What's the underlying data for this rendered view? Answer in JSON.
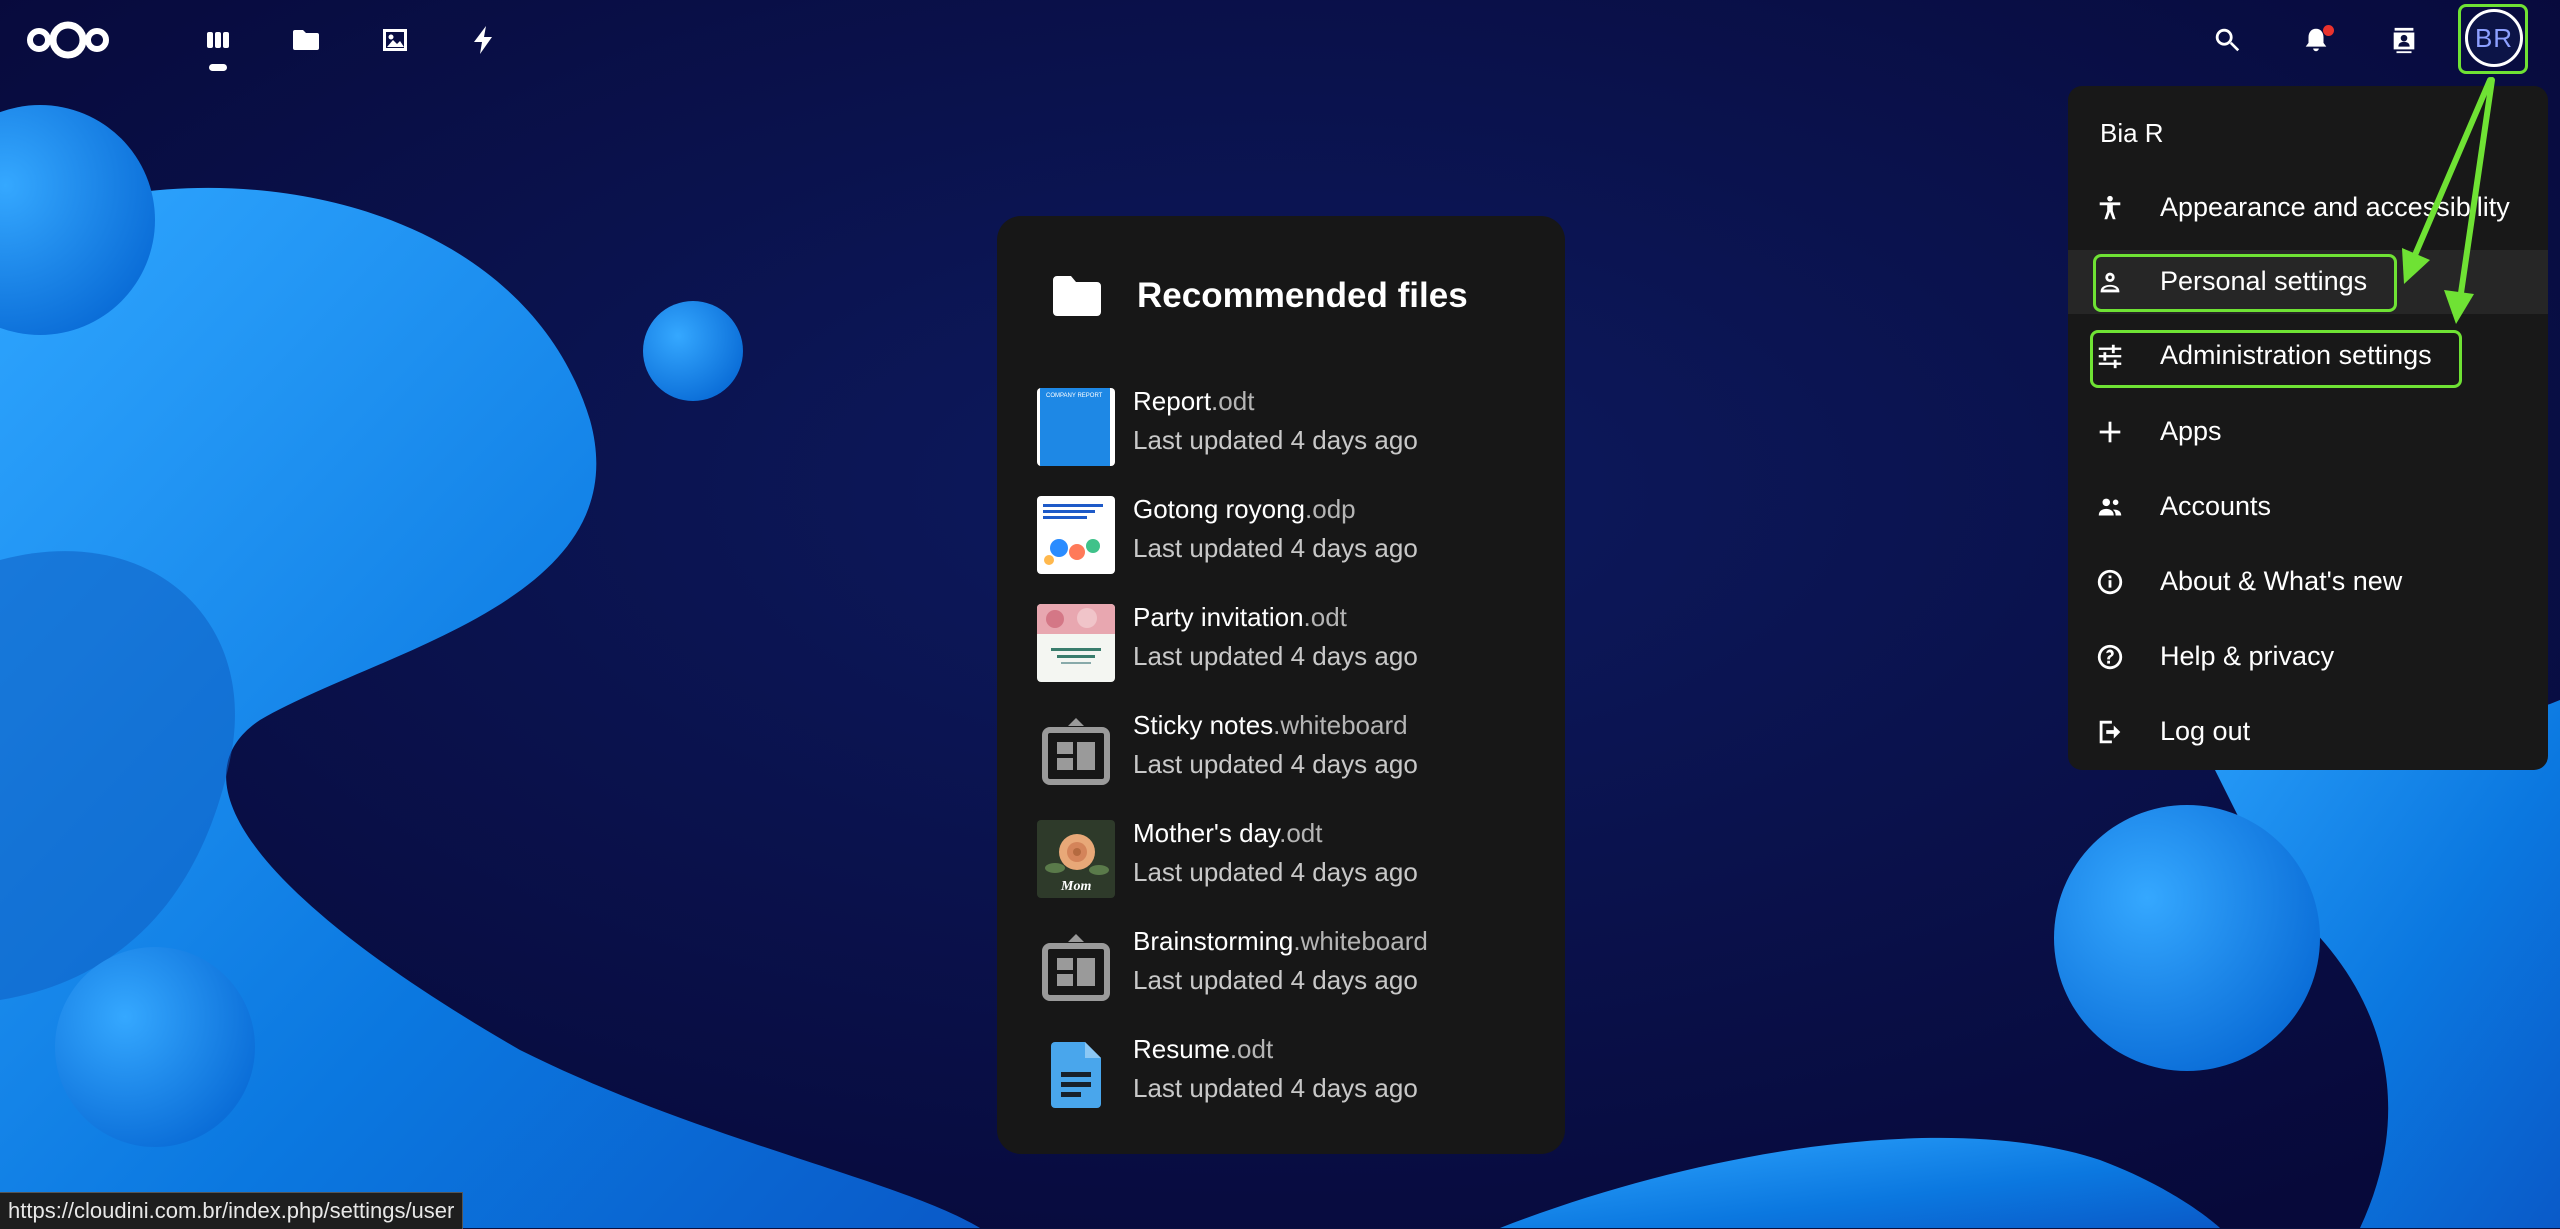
{
  "topbar": {
    "apps": [
      {
        "name": "dashboard",
        "icon": "dashboard-icon",
        "active": true
      },
      {
        "name": "files",
        "icon": "folder-icon"
      },
      {
        "name": "photos",
        "icon": "image-icon"
      },
      {
        "name": "activity",
        "icon": "lightning-icon"
      }
    ],
    "right_icons": [
      "search-icon",
      "bell-icon",
      "contacts-icon"
    ],
    "avatar_initials": "BR"
  },
  "recommended": {
    "title": "Recommended files",
    "files": [
      {
        "name": "Report",
        "ext": ".odt",
        "updated": "Last updated 4 days ago",
        "thumb": "report-thumbnail"
      },
      {
        "name": "Gotong royong",
        "ext": ".odp",
        "updated": "Last updated 4 days ago",
        "thumb": "presentation-thumbnail"
      },
      {
        "name": "Party invitation",
        "ext": ".odt",
        "updated": "Last updated 4 days ago",
        "thumb": "invitation-thumbnail"
      },
      {
        "name": "Sticky notes",
        "ext": ".whiteboard",
        "updated": "Last updated 4 days ago",
        "thumb": "whiteboard-icon"
      },
      {
        "name": "Mother's day",
        "ext": ".odt",
        "updated": "Last updated 4 days ago",
        "thumb": "flower-thumbnail"
      },
      {
        "name": "Brainstorming",
        "ext": ".whiteboard",
        "updated": "Last updated 4 days ago",
        "thumb": "whiteboard-icon"
      },
      {
        "name": "Resume",
        "ext": ".odt",
        "updated": "Last updated 4 days ago",
        "thumb": "document-icon"
      }
    ]
  },
  "thumb_text": {
    "report": "COMPANY REPORT",
    "mom": "Mom"
  },
  "menu": {
    "user": "Bia R",
    "items": [
      {
        "label": "Appearance and accessibility",
        "icon": "accessibility-icon"
      },
      {
        "label": "Personal settings",
        "icon": "person-icon"
      },
      {
        "label": "Administration settings",
        "icon": "sliders-icon"
      },
      {
        "label": "Apps",
        "icon": "plus-icon"
      },
      {
        "label": "Accounts",
        "icon": "accounts-icon"
      },
      {
        "label": "About & What's new",
        "icon": "info-icon"
      },
      {
        "label": "Help & privacy",
        "icon": "help-icon"
      },
      {
        "label": "Log out",
        "icon": "logout-icon"
      }
    ]
  },
  "status_url": "https://cloudini.com.br/index.php/settings/user",
  "colors": {
    "highlight": "#6fe234",
    "background": "#0a0f3e",
    "blob": "#1e90f0",
    "card": "#171717",
    "menu": "#181818"
  }
}
